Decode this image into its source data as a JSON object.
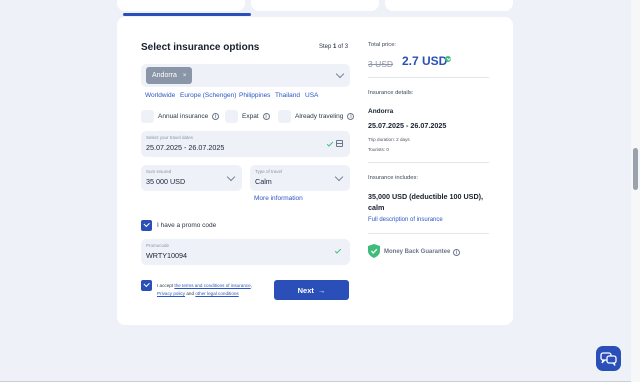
{
  "form": {
    "title": "Select insurance options",
    "step_prefix": "Step ",
    "step_current": "1",
    "step_suffix": " of 3",
    "selected_country": "Andorra",
    "chip_remove": "×",
    "quick_countries": [
      "Worldwide",
      "Europe (Schengen)",
      "Philippines",
      "Thailand",
      "USA"
    ],
    "options": [
      "Annual insurance",
      "Expat",
      "Already traveling"
    ],
    "dates": {
      "label": "Select your travel dates",
      "value": "25.07.2025 - 26.07.2025"
    },
    "sum": {
      "label": "Sum insured",
      "value": "35 000 USD"
    },
    "travel_type": {
      "label": "Type of travel",
      "value": "Calm"
    },
    "more_info": "More information",
    "promo_checkbox_label": "I have a promo code",
    "promo": {
      "label": "Promocode",
      "value": "WRTY10094"
    },
    "terms": {
      "prefix": "I accept ",
      "link1": "the terms and conditions of insurance",
      "sep1": ", ",
      "link2": "Privacy policy",
      "sep2": " and ",
      "link3": "other legal conditions"
    },
    "next_label": "Next",
    "next_arrow": "→"
  },
  "summary": {
    "total_label": "Total price:",
    "old_price": "3 USD",
    "new_price": "2.7 USD",
    "details_label": "Insurance details:",
    "country": "Andorra",
    "dates": "25.07.2025 - 26.07.2025",
    "duration": "Trip duration: 2 days",
    "tourists": "Tourists: 0",
    "includes_label": "Insurance includes:",
    "includes_value": "35,000 USD (deductible 100 USD), calm",
    "full_desc_link": "Full description of insurance",
    "guarantee": "Money Back Guarantee"
  },
  "colors": {
    "accent": "#2a4fb8",
    "link": "#2a55c2",
    "success": "#3ebd7a",
    "field_bg": "#eef2f8"
  },
  "icons": [
    "info-icon",
    "chevron-down-icon",
    "calendar-icon",
    "check-icon",
    "shield-icon",
    "chat-icon",
    "arrow-right-icon"
  ]
}
